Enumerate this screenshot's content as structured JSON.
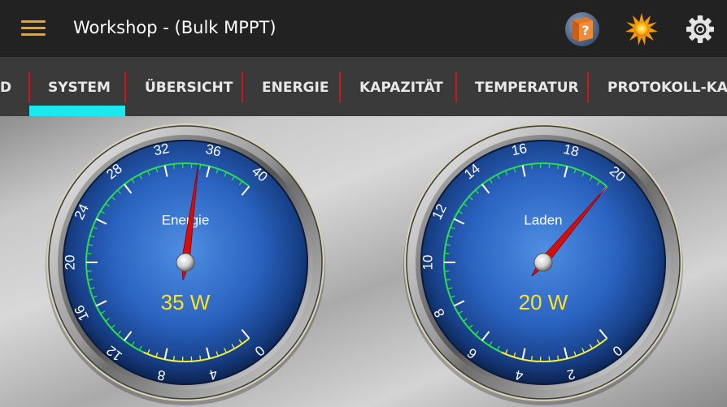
{
  "topbar": {
    "title": "Workshop - (Bulk MPPT)",
    "icons": [
      "menu-icon",
      "help-book-icon",
      "sun-icon",
      "settings-gear-icon"
    ]
  },
  "tabs": [
    {
      "label": "D"
    },
    {
      "label": "SYSTEM",
      "selected": true
    },
    {
      "label": "ÜBERSICHT"
    },
    {
      "label": "ENERGIE"
    },
    {
      "label": "KAPAZITÄT"
    },
    {
      "label": "TEMPERATUR"
    },
    {
      "label": "PROTOKOLL-KALI"
    }
  ],
  "gauges": [
    {
      "title": "Energie",
      "value_text": "35 W",
      "value": 35,
      "min": 0,
      "max": 40,
      "ticks": [
        "0",
        "4",
        "8",
        "12",
        "16",
        "20",
        "24",
        "28",
        "32",
        "36",
        "40"
      ],
      "needle_value": 35
    },
    {
      "title": "Laden",
      "value_text": "20 W",
      "value": 20,
      "min": 0,
      "max": 20,
      "ticks": [
        "0",
        "2",
        "4",
        "6",
        "8",
        "10",
        "12",
        "14",
        "16",
        "18",
        "20"
      ],
      "needle_value": 20
    }
  ],
  "colors": {
    "accent_menu": "#f0a21e",
    "tab_indicator": "#19e8ef",
    "tab_separator": "#c91818",
    "gauge_value_text": "#ffe21f",
    "gauge_scale_green": "#29e04a",
    "gauge_scale_yellow": "#f4ef3a",
    "needle": "#d40d0d"
  }
}
